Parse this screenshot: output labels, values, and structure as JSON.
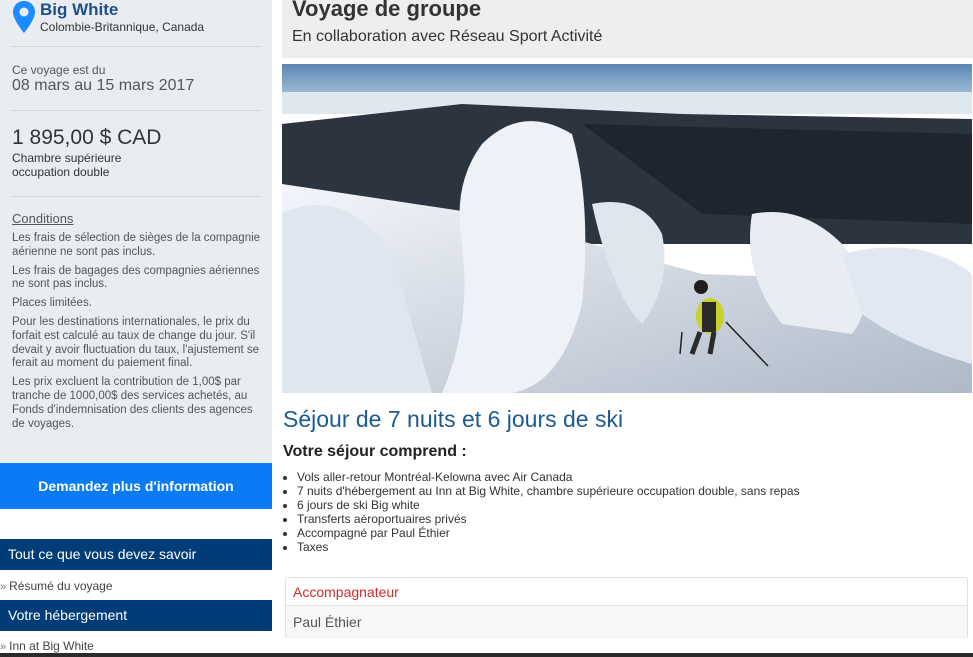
{
  "location": {
    "name": "Big White",
    "region": "Colombie-Britannique, Canada",
    "icon": "map-pin-icon",
    "color": "#1a8cff"
  },
  "trip": {
    "label": "Ce voyage est du",
    "dates": "08 mars au 15 mars 2017"
  },
  "price": {
    "amount": "1 895,00 $ CAD",
    "room_line1": "Chambre supérieure",
    "room_line2": "occupation double"
  },
  "conditions": {
    "title": "Conditions",
    "items": [
      "Les frais de sélection de sièges de la compagnie aérienne ne sont pas inclus.",
      "Les frais de bagages des compagnies aériennes ne sont pas inclus.",
      "Places limitées.",
      "Pour les destinations internationales, le prix du forfait est calculé au taux de change du jour. S'il devait y avoir fluctuation du taux, l'ajustement se ferait au moment du paiement final.",
      "Les prix excluent la contribution de 1,00$ par tranche de 1000,00$ des services achetés, au Fonds d'indemnisation des clients des agences de voyages."
    ]
  },
  "cta": {
    "label": "Demandez plus d'information",
    "color": "#0a7bf5"
  },
  "nav": {
    "sections": [
      {
        "title": "Tout ce que vous devez savoir",
        "item": "Résumé du voyage"
      },
      {
        "title": "Votre hébergement",
        "item": "Inn at Big White"
      }
    ],
    "color": "#003d78"
  },
  "header": {
    "title": "Voyage de groupe",
    "subtitle": "En collaboration avec Réseau Sport Activité"
  },
  "main": {
    "hero_alt_icon": "ski-landscape-photo",
    "title": "Séjour de 7 nuits et 6 jours de ski",
    "includes_title": "Votre séjour comprend :",
    "includes": [
      "Vols aller-retour Montréal-Kelowna avec Air Canada",
      "7 nuits d'hébergement au Inn at Big White, chambre supérieure occupation double, sans repas",
      "6 jours de ski Big white",
      "Transferts aéroportuaires privés",
      "Accompagné par Paul Éthier",
      "Taxes"
    ]
  },
  "accompagnateur": {
    "heading": "Accompagnateur",
    "name": "Paul Éthier"
  }
}
